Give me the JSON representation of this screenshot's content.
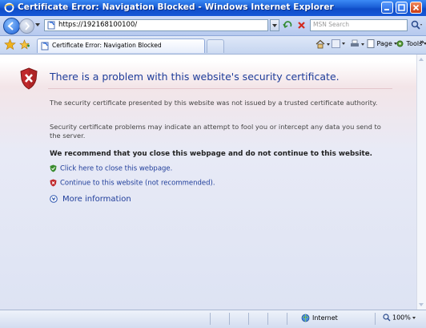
{
  "window": {
    "title": "Certificate Error: Navigation Blocked - Windows Internet Explorer"
  },
  "address_bar": {
    "url": "https://192168100100/",
    "search_placeholder": "MSN Search"
  },
  "tab": {
    "label": "Certificate Error: Navigation Blocked"
  },
  "command_bar": {
    "page_label": "Page",
    "tools_label": "Tools"
  },
  "page": {
    "heading": "There is a problem with this website's security certificate.",
    "paragraph1": "The security certificate presented by this website was not issued by a trusted certificate authority.",
    "paragraph2": "Security certificate problems may indicate an attempt to fool you or intercept any data you send to the server.",
    "recommendation": "We recommend that you close this webpage and do not continue to this website.",
    "close_link": "Click here to close this webpage.",
    "continue_link": "Continue to this website (not recommended).",
    "more_info": "More information"
  },
  "status_bar": {
    "zone": "Internet",
    "zoom": "100%"
  },
  "colors": {
    "title_bar": "#1a5fd6",
    "heading": "#1f3d9a",
    "shield_red": "#c0282b",
    "safe_green": "#3a8c2f"
  }
}
